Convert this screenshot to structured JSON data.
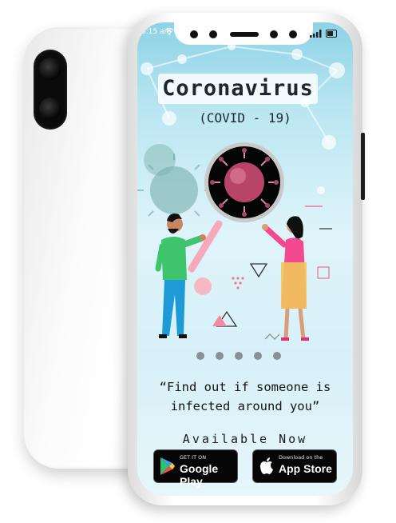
{
  "status_bar": {
    "time": "5:15 am"
  },
  "app": {
    "title": "Coronavirus",
    "subtitle": "(COVID - 19)",
    "quote": "“Find out if someone is infected around you”",
    "availability": "Available Now"
  },
  "carousel": {
    "dots": 5
  },
  "store_buttons": {
    "google": {
      "small": "GET IT ON",
      "big": "Google Play",
      "icon": "google-play-icon"
    },
    "apple": {
      "small": "Download on the",
      "big": "App Store",
      "icon": "apple-icon"
    }
  },
  "colors": {
    "screen_top": "#8dd2e6",
    "screen_bottom": "#e6f6fb",
    "virus": "#b8446a",
    "accent_pink": "#f28aa6",
    "dress": "#f2498f",
    "shirt": "#3ec46d",
    "jeans": "#1e9bd7",
    "store_button": "#060606"
  }
}
